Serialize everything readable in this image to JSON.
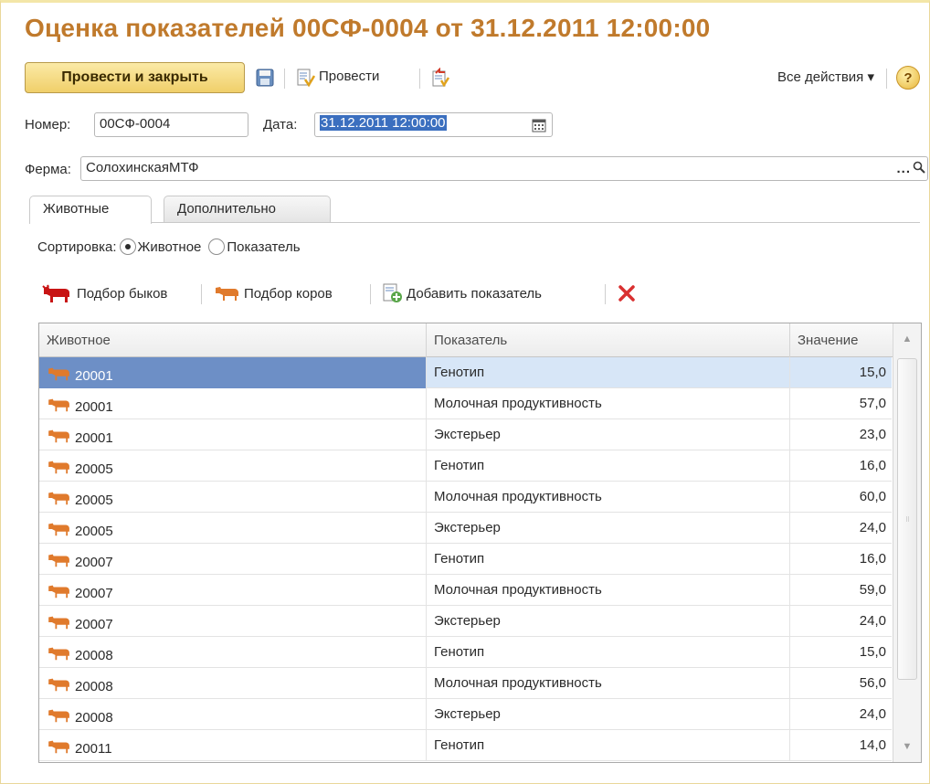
{
  "window": {
    "title": "Оценка показателей 00СФ-0004 от 31.12.2011 12:00:00"
  },
  "toolbar": {
    "post_and_close": "Провести и закрыть",
    "post": "Провести",
    "all_actions": "Все действия ▾",
    "help": "?"
  },
  "form": {
    "number_label": "Номер:",
    "number_value": "00СФ-0004",
    "date_label": "Дата:",
    "date_value": "31.12.2011 12:00:00",
    "farm_label": "Ферма:",
    "farm_value": "СолохинскаяМТФ",
    "farm_select": "..."
  },
  "tabs": [
    {
      "label": "Животные",
      "active": true
    },
    {
      "label": "Дополнительно",
      "active": false
    }
  ],
  "sort": {
    "label": "Сортировка:",
    "options": [
      {
        "label": "Животное",
        "checked": true
      },
      {
        "label": "Показатель",
        "checked": false
      }
    ]
  },
  "commands": {
    "pick_bulls": "Подбор быков",
    "pick_cows": "Подбор коров",
    "add_indicator": "Добавить показатель"
  },
  "table": {
    "columns": [
      "Животное",
      "Показатель",
      "Значение"
    ],
    "rows": [
      {
        "animal": "20001",
        "indicator": "Генотип",
        "value": "15,0",
        "selected": true
      },
      {
        "animal": "20001",
        "indicator": "Молочная продуктивность",
        "value": "57,0"
      },
      {
        "animal": "20001",
        "indicator": "Экстерьер",
        "value": "23,0"
      },
      {
        "animal": "20005",
        "indicator": "Генотип",
        "value": "16,0"
      },
      {
        "animal": "20005",
        "indicator": "Молочная продуктивность",
        "value": "60,0"
      },
      {
        "animal": "20005",
        "indicator": "Экстерьер",
        "value": "24,0"
      },
      {
        "animal": "20007",
        "indicator": "Генотип",
        "value": "16,0"
      },
      {
        "animal": "20007",
        "indicator": "Молочная продуктивность",
        "value": "59,0"
      },
      {
        "animal": "20007",
        "indicator": "Экстерьер",
        "value": "24,0"
      },
      {
        "animal": "20008",
        "indicator": "Генотип",
        "value": "15,0"
      },
      {
        "animal": "20008",
        "indicator": "Молочная продуктивность",
        "value": "56,0"
      },
      {
        "animal": "20008",
        "indicator": "Экстерьер",
        "value": "24,0"
      },
      {
        "animal": "20011",
        "indicator": "Генотип",
        "value": "14,0"
      }
    ]
  },
  "colors": {
    "title": "#c07a2c",
    "selection": "#3b6fbf",
    "cow_icon": "#e07a2c",
    "bull_icon": "#c81414",
    "delete_icon": "#d93030"
  },
  "icons": {
    "save": "floppy-disk-icon",
    "post": "document-post-icon",
    "unpost": "document-unpost-icon",
    "calendar": "calendar-icon",
    "search": "search-icon",
    "bull": "bull-icon",
    "cow": "cow-icon",
    "add": "document-add-icon",
    "delete": "delete-x-icon"
  }
}
